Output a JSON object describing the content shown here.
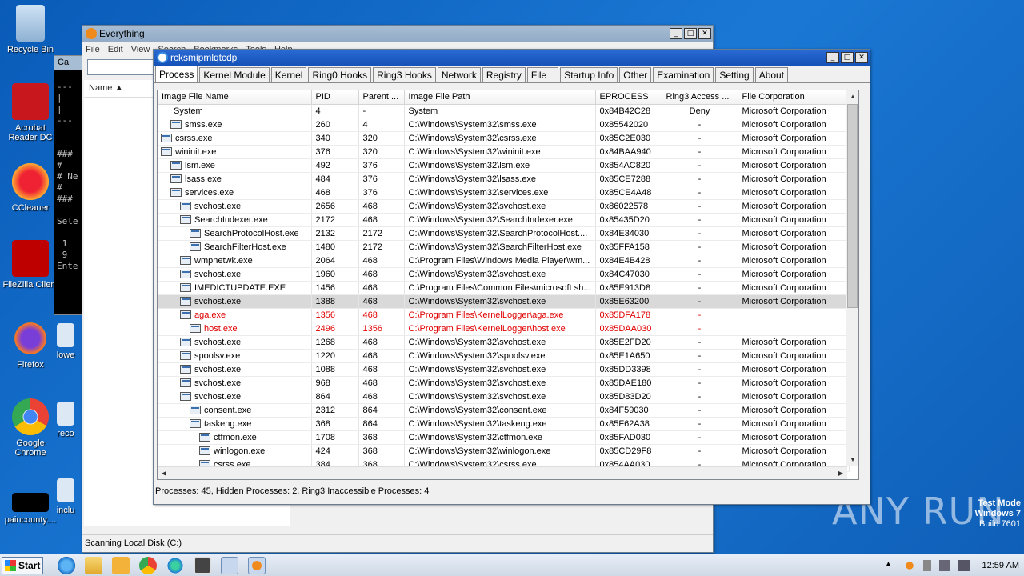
{
  "desktop": {
    "icons": [
      {
        "label": "Recycle Bin"
      },
      {
        "label": "Acrobat Reader DC"
      },
      {
        "label": "CCleaner"
      },
      {
        "label": "FileZilla Client"
      },
      {
        "label": "Firefox"
      },
      {
        "label": "Google Chrome"
      },
      {
        "label": "paincounty...."
      },
      {
        "label": "lowe"
      },
      {
        "label": "reco"
      },
      {
        "label": "inclu"
      }
    ],
    "watermark": {
      "line1": "Test Mode",
      "line2": "Windows 7",
      "line3": "Build 7601"
    },
    "brand": "ANY RUN"
  },
  "everything": {
    "title": "Everything",
    "menu": [
      "File",
      "Edit",
      "View",
      "Search",
      "Bookmarks",
      "Tools",
      "Help"
    ],
    "column_name": "Name",
    "status": "Scanning Local Disk (C:)"
  },
  "console": {
    "title": "Ca",
    "lines": [
      "",
      "---",
      "|",
      "|",
      "---",
      "",
      "",
      "###",
      "#",
      "# Ne",
      "# '",
      "###",
      "",
      "Sele",
      "",
      " 1",
      " 9",
      "Ente"
    ]
  },
  "tool": {
    "title": "rcksmipmlqtcdp",
    "tabs": [
      "Process",
      "Kernel Module",
      "Kernel",
      "Ring0 Hooks",
      "Ring3 Hooks",
      "Network",
      "Registry",
      "File",
      "Startup Info",
      "Other",
      "Examination",
      "Setting",
      "About"
    ],
    "columns": [
      "Image File Name",
      "PID",
      "Parent ...",
      "Image File Path",
      "EPROCESS",
      "Ring3 Access ...",
      "File Corporation"
    ],
    "rows": [
      {
        "name": "System",
        "pid": "4",
        "parent": "-",
        "path": "System",
        "eprocess": "0x84B42C28",
        "ring3": "Deny",
        "corp": "Microsoft Corporation",
        "indent": 0,
        "icon": false
      },
      {
        "name": "smss.exe",
        "pid": "260",
        "parent": "4",
        "path": "C:\\Windows\\System32\\smss.exe",
        "eprocess": "0x85542020",
        "ring3": "-",
        "corp": "Microsoft Corporation",
        "indent": 1,
        "icon": true
      },
      {
        "name": "csrss.exe",
        "pid": "340",
        "parent": "320",
        "path": "C:\\Windows\\System32\\csrss.exe",
        "eprocess": "0x85C2E030",
        "ring3": "-",
        "corp": "Microsoft Corporation",
        "indent": 0,
        "icon": true
      },
      {
        "name": "wininit.exe",
        "pid": "376",
        "parent": "320",
        "path": "C:\\Windows\\System32\\wininit.exe",
        "eprocess": "0x84BAA940",
        "ring3": "-",
        "corp": "Microsoft Corporation",
        "indent": 0,
        "icon": true
      },
      {
        "name": "lsm.exe",
        "pid": "492",
        "parent": "376",
        "path": "C:\\Windows\\System32\\lsm.exe",
        "eprocess": "0x854AC820",
        "ring3": "-",
        "corp": "Microsoft Corporation",
        "indent": 1,
        "icon": true
      },
      {
        "name": "lsass.exe",
        "pid": "484",
        "parent": "376",
        "path": "C:\\Windows\\System32\\lsass.exe",
        "eprocess": "0x85CE7288",
        "ring3": "-",
        "corp": "Microsoft Corporation",
        "indent": 1,
        "icon": true
      },
      {
        "name": "services.exe",
        "pid": "468",
        "parent": "376",
        "path": "C:\\Windows\\System32\\services.exe",
        "eprocess": "0x85CE4A48",
        "ring3": "-",
        "corp": "Microsoft Corporation",
        "indent": 1,
        "icon": true
      },
      {
        "name": "svchost.exe",
        "pid": "2656",
        "parent": "468",
        "path": "C:\\Windows\\System32\\svchost.exe",
        "eprocess": "0x86022578",
        "ring3": "-",
        "corp": "Microsoft Corporation",
        "indent": 2,
        "icon": true
      },
      {
        "name": "SearchIndexer.exe",
        "pid": "2172",
        "parent": "468",
        "path": "C:\\Windows\\System32\\SearchIndexer.exe",
        "eprocess": "0x85435D20",
        "ring3": "-",
        "corp": "Microsoft Corporation",
        "indent": 2,
        "icon": true
      },
      {
        "name": "SearchProtocolHost.exe",
        "pid": "2132",
        "parent": "2172",
        "path": "C:\\Windows\\System32\\SearchProtocolHost....",
        "eprocess": "0x84E34030",
        "ring3": "-",
        "corp": "Microsoft Corporation",
        "indent": 3,
        "icon": true
      },
      {
        "name": "SearchFilterHost.exe",
        "pid": "1480",
        "parent": "2172",
        "path": "C:\\Windows\\System32\\SearchFilterHost.exe",
        "eprocess": "0x85FFA158",
        "ring3": "-",
        "corp": "Microsoft Corporation",
        "indent": 3,
        "icon": true
      },
      {
        "name": "wmpnetwk.exe",
        "pid": "2064",
        "parent": "468",
        "path": "C:\\Program Files\\Windows Media Player\\wm...",
        "eprocess": "0x84E4B428",
        "ring3": "-",
        "corp": "Microsoft Corporation",
        "indent": 2,
        "icon": true
      },
      {
        "name": "svchost.exe",
        "pid": "1960",
        "parent": "468",
        "path": "C:\\Windows\\System32\\svchost.exe",
        "eprocess": "0x84C47030",
        "ring3": "-",
        "corp": "Microsoft Corporation",
        "indent": 2,
        "icon": true
      },
      {
        "name": "IMEDICTUPDATE.EXE",
        "pid": "1456",
        "parent": "468",
        "path": "C:\\Program Files\\Common Files\\microsoft sh...",
        "eprocess": "0x85E913D8",
        "ring3": "-",
        "corp": "Microsoft Corporation",
        "indent": 2,
        "icon": true
      },
      {
        "name": "svchost.exe",
        "pid": "1388",
        "parent": "468",
        "path": "C:\\Windows\\System32\\svchost.exe",
        "eprocess": "0x85E63200",
        "ring3": "-",
        "corp": "Microsoft Corporation",
        "indent": 2,
        "icon": true,
        "selected": true
      },
      {
        "name": "aga.exe",
        "pid": "1356",
        "parent": "468",
        "path": "C:\\Program Files\\KernelLogger\\aga.exe",
        "eprocess": "0x85DFA178",
        "ring3": "-",
        "corp": "",
        "indent": 2,
        "icon": true,
        "hidden": true
      },
      {
        "name": "host.exe",
        "pid": "2496",
        "parent": "1356",
        "path": "C:\\Program Files\\KernelLogger\\host.exe",
        "eprocess": "0x85DAA030",
        "ring3": "-",
        "corp": "",
        "indent": 3,
        "icon": true,
        "hidden": true
      },
      {
        "name": "svchost.exe",
        "pid": "1268",
        "parent": "468",
        "path": "C:\\Windows\\System32\\svchost.exe",
        "eprocess": "0x85E2FD20",
        "ring3": "-",
        "corp": "Microsoft Corporation",
        "indent": 2,
        "icon": true
      },
      {
        "name": "spoolsv.exe",
        "pid": "1220",
        "parent": "468",
        "path": "C:\\Windows\\System32\\spoolsv.exe",
        "eprocess": "0x85E1A650",
        "ring3": "-",
        "corp": "Microsoft Corporation",
        "indent": 2,
        "icon": true
      },
      {
        "name": "svchost.exe",
        "pid": "1088",
        "parent": "468",
        "path": "C:\\Windows\\System32\\svchost.exe",
        "eprocess": "0x85DD3398",
        "ring3": "-",
        "corp": "Microsoft Corporation",
        "indent": 2,
        "icon": true
      },
      {
        "name": "svchost.exe",
        "pid": "968",
        "parent": "468",
        "path": "C:\\Windows\\System32\\svchost.exe",
        "eprocess": "0x85DAE180",
        "ring3": "-",
        "corp": "Microsoft Corporation",
        "indent": 2,
        "icon": true
      },
      {
        "name": "svchost.exe",
        "pid": "864",
        "parent": "468",
        "path": "C:\\Windows\\System32\\svchost.exe",
        "eprocess": "0x85D83D20",
        "ring3": "-",
        "corp": "Microsoft Corporation",
        "indent": 2,
        "icon": true
      },
      {
        "name": "consent.exe",
        "pid": "2312",
        "parent": "864",
        "path": "C:\\Windows\\System32\\consent.exe",
        "eprocess": "0x84F59030",
        "ring3": "-",
        "corp": "Microsoft Corporation",
        "indent": 3,
        "icon": true
      },
      {
        "name": "taskeng.exe",
        "pid": "368",
        "parent": "864",
        "path": "C:\\Windows\\System32\\taskeng.exe",
        "eprocess": "0x85F62A38",
        "ring3": "-",
        "corp": "Microsoft Corporation",
        "indent": 3,
        "icon": true
      },
      {
        "name": "ctfmon.exe",
        "pid": "1708",
        "parent": "368",
        "path": "C:\\Windows\\System32\\ctfmon.exe",
        "eprocess": "0x85FAD030",
        "ring3": "-",
        "corp": "Microsoft Corporation",
        "indent": 4,
        "icon": true
      },
      {
        "name": "winlogon.exe",
        "pid": "424",
        "parent": "368",
        "path": "C:\\Windows\\System32\\winlogon.exe",
        "eprocess": "0x85CD29F8",
        "ring3": "-",
        "corp": "Microsoft Corporation",
        "indent": 4,
        "icon": true
      },
      {
        "name": "csrss.exe",
        "pid": "384",
        "parent": "368",
        "path": "C:\\Windows\\System32\\csrss.exe",
        "eprocess": "0x854AA030",
        "ring3": "-",
        "corp": "Microsoft Corporation",
        "indent": 4,
        "icon": true
      }
    ],
    "status": "Processes: 45, Hidden Processes: 2, Ring3 Inaccessible Processes: 4"
  },
  "taskbar": {
    "start_label": "Start",
    "clock": "12:59 AM",
    "apps": [
      "ie-icon",
      "explorer-icon",
      "media-player-icon",
      "chrome-icon",
      "edge-icon",
      "console-icon",
      "tool-icon",
      "everything-icon"
    ]
  },
  "colors": {
    "hidden_process": "#e00000",
    "selected_row": "#d9d9d9",
    "titlebar_active": "#1452b8"
  }
}
